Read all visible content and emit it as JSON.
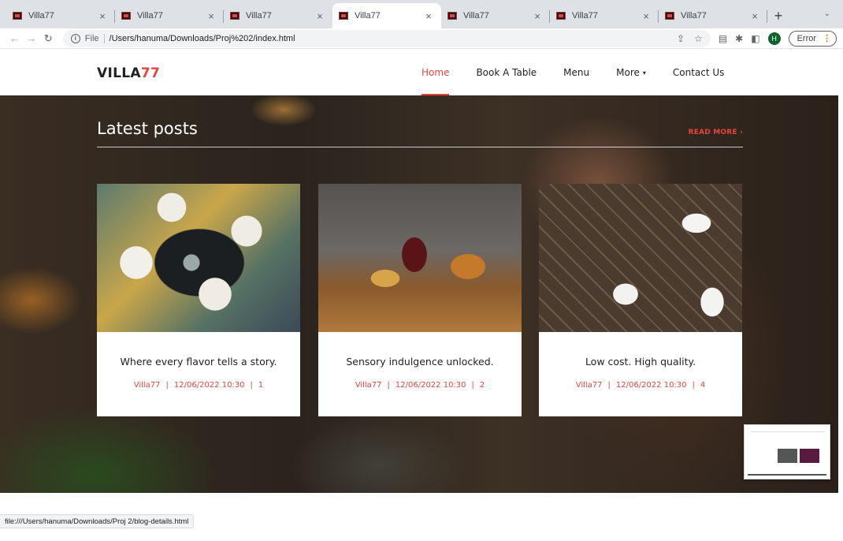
{
  "browser": {
    "tabs": [
      {
        "title": "Villa77",
        "active": false
      },
      {
        "title": "Villa77",
        "active": false
      },
      {
        "title": "Villa77",
        "active": false
      },
      {
        "title": "Villa77",
        "active": true
      },
      {
        "title": "Villa77",
        "active": false
      },
      {
        "title": "Villa77",
        "active": false
      },
      {
        "title": "Villa77",
        "active": false
      }
    ],
    "close_glyph": "×",
    "new_tab_glyph": "+",
    "tab_menu_glyph": "⌄",
    "back_glyph": "←",
    "forward_glyph": "→",
    "reload_glyph": "↻",
    "info_glyph": "i",
    "scheme_label": "File",
    "url": "/Users/hanuma/Downloads/Proj%202/index.html",
    "share_glyph": "⇪",
    "star_glyph": "☆",
    "reading_glyph": "▤",
    "extensions_glyph": "✱",
    "sidepanel_glyph": "◧",
    "avatar_initial": "H",
    "error_label": "Error",
    "menu_glyph": "⋮",
    "status_url": "file:///Users/hanuma/Downloads/Proj 2/blog-details.html"
  },
  "site": {
    "logo_main": "VILLA",
    "logo_accent": "77",
    "nav": [
      {
        "label": "Home",
        "active": true
      },
      {
        "label": "Book A Table",
        "active": false
      },
      {
        "label": "Menu",
        "active": false
      },
      {
        "label": "More",
        "active": false
      },
      {
        "label": "Contact Us",
        "active": false
      }
    ],
    "caret_glyph": "▾"
  },
  "hero": {
    "title": "Latest posts",
    "read_more": "READ MORE ›"
  },
  "posts": [
    {
      "title": "Where every flavor tells a story.",
      "author": "Villa77",
      "date": "12/06/2022 10:30",
      "count": "1"
    },
    {
      "title": "Sensory indulgence unlocked.",
      "author": "Villa77",
      "date": "12/06/2022 10:30",
      "count": "2"
    },
    {
      "title": "Low cost. High quality.",
      "author": "Villa77",
      "date": "12/06/2022 10:30",
      "count": "4"
    }
  ],
  "meta_separator": "|",
  "colors": {
    "accent": "#e2453c",
    "text": "#222222",
    "chrome": "#dee1e6"
  }
}
